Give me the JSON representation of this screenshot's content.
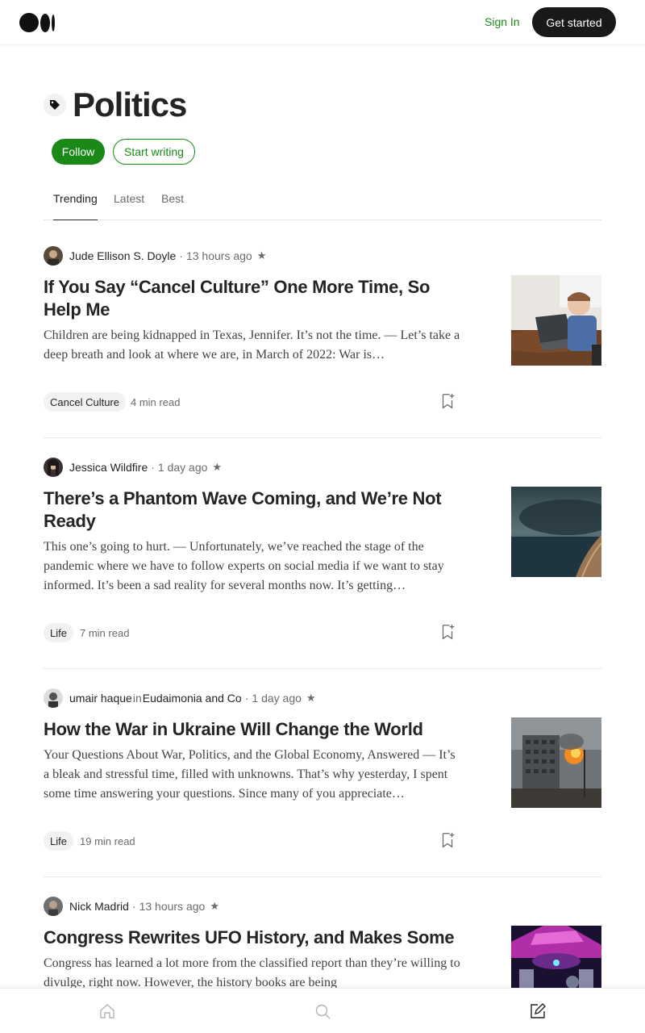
{
  "header": {
    "sign_in": "Sign In",
    "get_started": "Get started"
  },
  "topic": {
    "title": "Politics",
    "follow": "Follow",
    "start_writing": "Start writing"
  },
  "tabs": [
    {
      "label": "Trending",
      "active": true
    },
    {
      "label": "Latest",
      "active": false
    },
    {
      "label": "Best",
      "active": false
    }
  ],
  "articles": [
    {
      "author": "Jude Ellison S. Doyle",
      "publication": "",
      "time": "13 hours ago",
      "title": "If You Say “Cancel Culture” One More Time, So Help Me",
      "excerpt": "Children are being kidnapped in Texas, Jennifer. It’s not the time. — Let’s take a deep breath and look at where we are, in March of 2022: War is…",
      "tag": "Cancel Culture",
      "read_time": "4 min read"
    },
    {
      "author": "Jessica Wildfire",
      "publication": "",
      "time": "1 day ago",
      "title": "There’s a Phantom Wave Coming, and We’re Not Ready",
      "excerpt": "This one’s going to hurt. — Unfortunately, we’ve reached the stage of the pandemic where we have to follow experts on social media if we want to stay informed. It’s been a sad reality for several months now. It’s getting…",
      "tag": "Life",
      "read_time": "7 min read"
    },
    {
      "author": "umair haque",
      "in": "in",
      "publication": "Eudaimonia and Co",
      "time": "1 day ago",
      "title": "How the War in Ukraine Will Change the World",
      "excerpt": "Your Questions About War, Politics, and the Global Economy, Answered — It’s a bleak and stressful time, filled with unknowns. That’s why yesterday, I spent some time answering your questions. Since many of you appreciate…",
      "tag": "Life",
      "read_time": "19 min read"
    },
    {
      "author": "Nick Madrid",
      "publication": "",
      "time": "13 hours ago",
      "title": "Congress Rewrites UFO History, and Makes Some",
      "excerpt": "Congress has learned a lot more from the classified report than they’re willing to divulge, right now. However, the history books are being",
      "tag": "",
      "read_time": ""
    }
  ],
  "separators": {
    "dot": "·",
    "star": "★"
  },
  "colors": {
    "accent": "#1a8917",
    "dark": "#191919"
  },
  "icons": [
    "medium-logo",
    "tag-icon",
    "bookmark-add-icon",
    "home-icon",
    "search-icon",
    "write-icon"
  ]
}
